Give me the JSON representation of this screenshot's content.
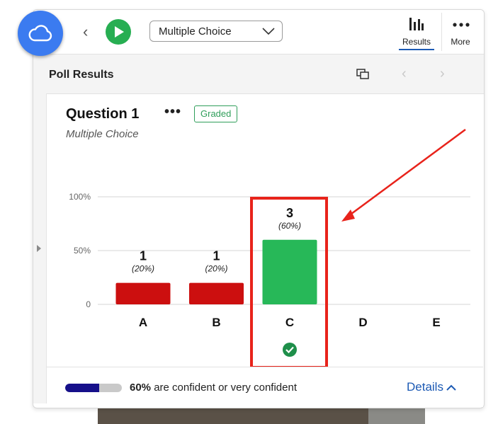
{
  "toolbar": {
    "question_type": "Multiple Choice",
    "results_label": "Results",
    "more_label": "More"
  },
  "results_panel": {
    "title": "Poll Results"
  },
  "question": {
    "title": "Question 1",
    "more": "•••",
    "badge": "Graded",
    "subtitle": "Multiple Choice"
  },
  "chart_data": {
    "type": "bar",
    "categories": [
      "A",
      "B",
      "C",
      "D",
      "E"
    ],
    "values": [
      20,
      20,
      60,
      0,
      0
    ],
    "counts": [
      "1",
      "1",
      "3",
      "",
      ""
    ],
    "percent_labels": [
      "(20%)",
      "(20%)",
      "(60%)",
      "",
      ""
    ],
    "correct": [
      false,
      false,
      true,
      false,
      false
    ],
    "ytick_labels": [
      "0",
      "50%",
      "100%"
    ],
    "ylim": [
      0,
      100
    ],
    "colors": {
      "incorrect": "#cc0f0f",
      "correct": "#27b858",
      "grid": "#d6d6d6"
    }
  },
  "footer": {
    "confidence_value": 60,
    "confidence_percent": "60%",
    "confidence_text": " are confident or very confident",
    "details_label": "Details"
  },
  "colors": {
    "accent": "#1c5ab4",
    "play": "#27ae52",
    "logo": "#3b7bf0",
    "annotation": "#e8231b"
  }
}
